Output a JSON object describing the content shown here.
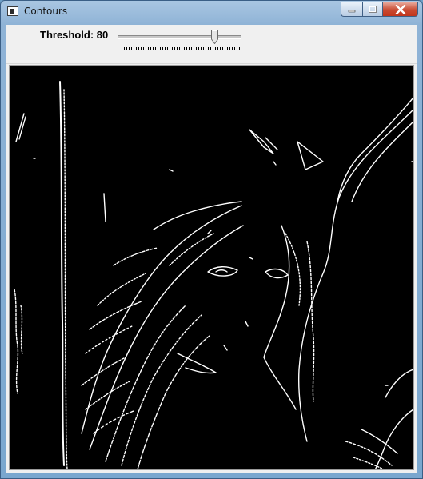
{
  "window": {
    "title": "Contours",
    "icon": "app-window-icon",
    "buttons": {
      "minimize": "minimize-icon",
      "maximize": "maximize-icon",
      "close": "close-icon"
    }
  },
  "toolbar": {
    "threshold_label": "Threshold: 80",
    "slider": {
      "value": 80,
      "min": 0,
      "max": 100
    }
  },
  "canvas": {
    "description_icon": "contour-image",
    "background_color": "#000000",
    "stroke_color": "#ffffff"
  }
}
